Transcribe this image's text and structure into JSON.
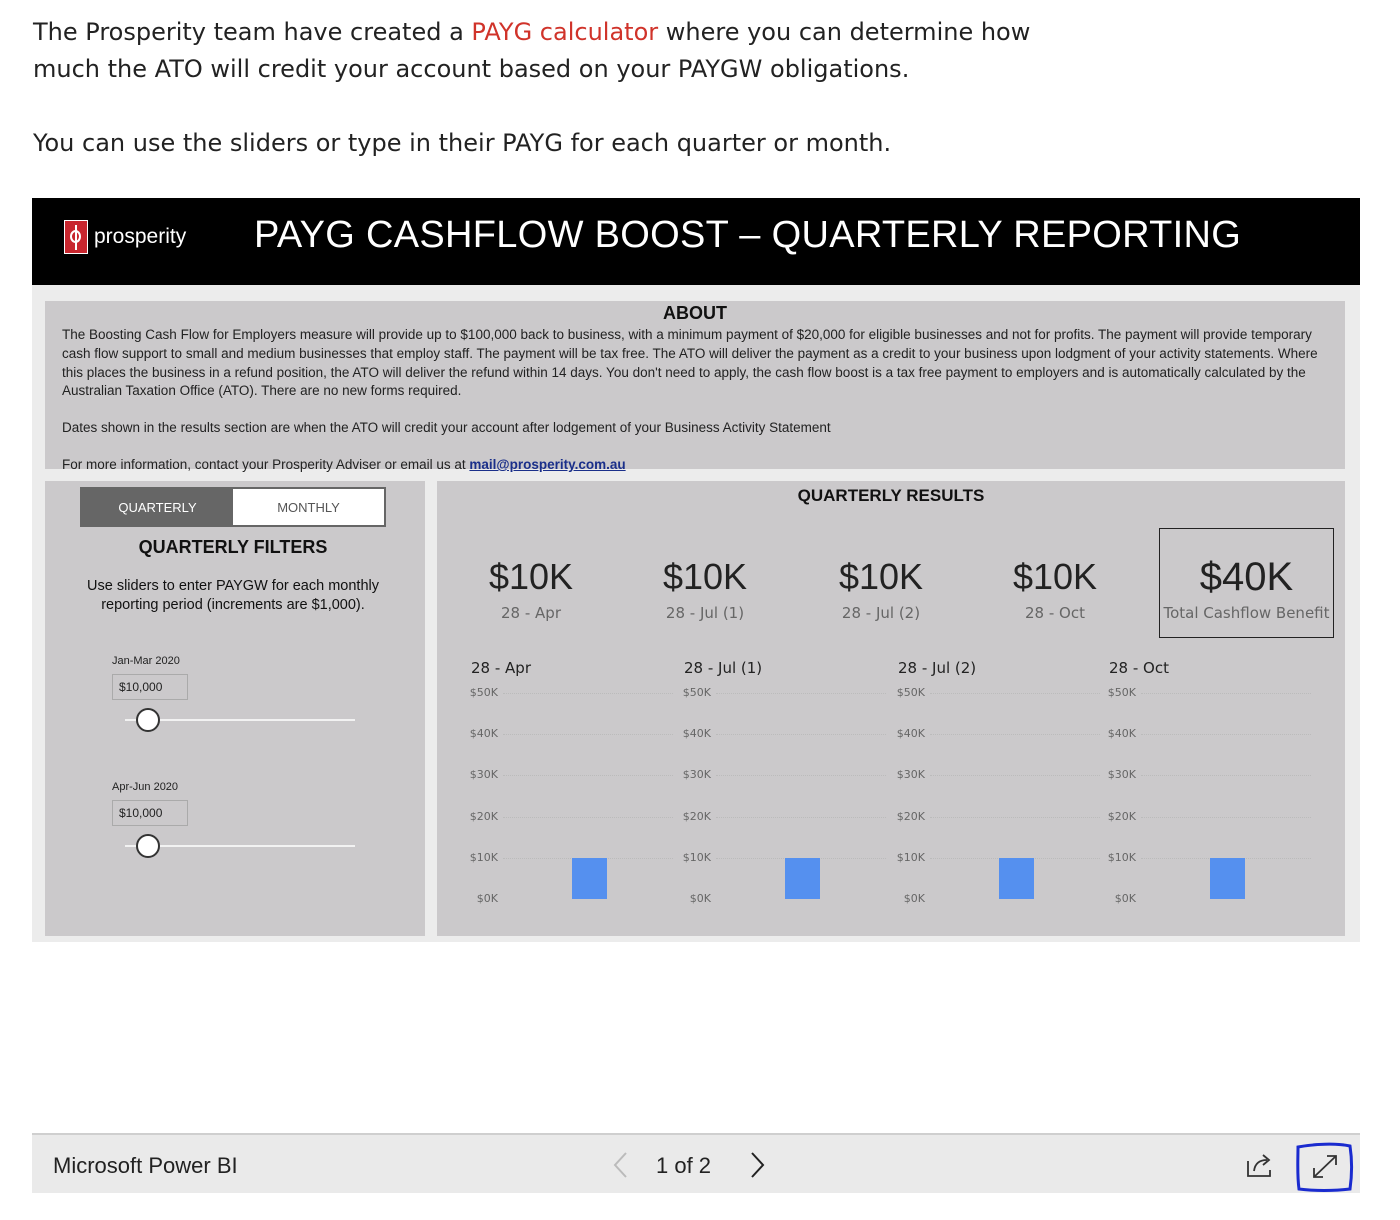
{
  "intro": {
    "line1_before": "The Prosperity team have created a ",
    "link": "PAYG calculator",
    "line1_after": " where you can determine how",
    "line2": "much the ATO will credit your account based on your PAYGW obligations.",
    "line3": "You can use the sliders or type in their PAYG for each quarter or month."
  },
  "header": {
    "logo_text": "prosperity",
    "title": "PAYG CASHFLOW BOOST – QUARTERLY REPORTING"
  },
  "about": {
    "title": "ABOUT",
    "para1": "The Boosting Cash Flow for Employers measure will provide up to $100,000 back to business, with a minimum payment of $20,000 for eligible businesses and not for profits. The payment will provide temporary cash flow support to small and medium businesses that employ staff. The payment will be tax free.  The ATO will deliver the payment as a credit to your business upon lodgment of your activity statements. Where this places the business in a refund position, the ATO will deliver the refund within 14 days. You don't need to apply, the cash flow boost is a tax free payment to employers and is automatically calculated by the Australian Taxation Office (ATO). There are no new forms required.",
    "para2": "Dates shown in the results section are when the ATO will credit your account after lodgement of your Business Activity Statement",
    "para3_prefix": "For more information, contact your Prosperity Adviser or email us at ",
    "email": "mail@prosperity.com.au"
  },
  "filters": {
    "toggle_quarterly": "QUARTERLY",
    "toggle_monthly": "MONTHLY",
    "title": "QUARTERLY FILTERS",
    "description": "Use sliders to enter PAYGW for each monthly reporting period (increments are $1,000).",
    "sliders": [
      {
        "label": "Jan-Mar 2020",
        "value": "$10,000"
      },
      {
        "label": "Apr-Jun 2020",
        "value": "$10,000"
      }
    ]
  },
  "results": {
    "title": "QUARTERLY RESULTS",
    "kpis": [
      {
        "value": "$10K",
        "label": "28 - Apr"
      },
      {
        "value": "$10K",
        "label": "28 - Jul (1)"
      },
      {
        "value": "$10K",
        "label": "28 - Jul (2)"
      },
      {
        "value": "$10K",
        "label": "28 - Oct"
      }
    ],
    "total": {
      "value": "$40K",
      "label": "Total Cashflow Benefit"
    }
  },
  "chart_data": [
    {
      "type": "bar",
      "title": "28 - Apr",
      "categories": [
        ""
      ],
      "values": [
        10000
      ],
      "yticks": [
        "$50K",
        "$40K",
        "$30K",
        "$20K",
        "$10K",
        "$0K"
      ],
      "ylim": [
        0,
        50000
      ],
      "grid": true,
      "color": "#5590ef"
    },
    {
      "type": "bar",
      "title": "28 - Jul (1)",
      "categories": [
        ""
      ],
      "values": [
        10000
      ],
      "yticks": [
        "$50K",
        "$40K",
        "$30K",
        "$20K",
        "$10K",
        "$0K"
      ],
      "ylim": [
        0,
        50000
      ],
      "grid": true,
      "color": "#5590ef"
    },
    {
      "type": "bar",
      "title": "28 - Jul (2)",
      "categories": [
        ""
      ],
      "values": [
        10000
      ],
      "yticks": [
        "$50K",
        "$40K",
        "$30K",
        "$20K",
        "$10K",
        "$0K"
      ],
      "ylim": [
        0,
        50000
      ],
      "grid": true,
      "color": "#5590ef"
    },
    {
      "type": "bar",
      "title": "28 - Oct",
      "categories": [
        ""
      ],
      "values": [
        10000
      ],
      "yticks": [
        "$50K",
        "$40K",
        "$30K",
        "$20K",
        "$10K",
        "$0K"
      ],
      "ylim": [
        0,
        50000
      ],
      "grid": true,
      "color": "#5590ef"
    }
  ],
  "pbi_bar": {
    "brand": "Microsoft Power BI",
    "page_indicator": "1 of 2",
    "icons": [
      "chevron-left-icon",
      "chevron-right-icon",
      "share-icon",
      "fullscreen-icon"
    ]
  }
}
